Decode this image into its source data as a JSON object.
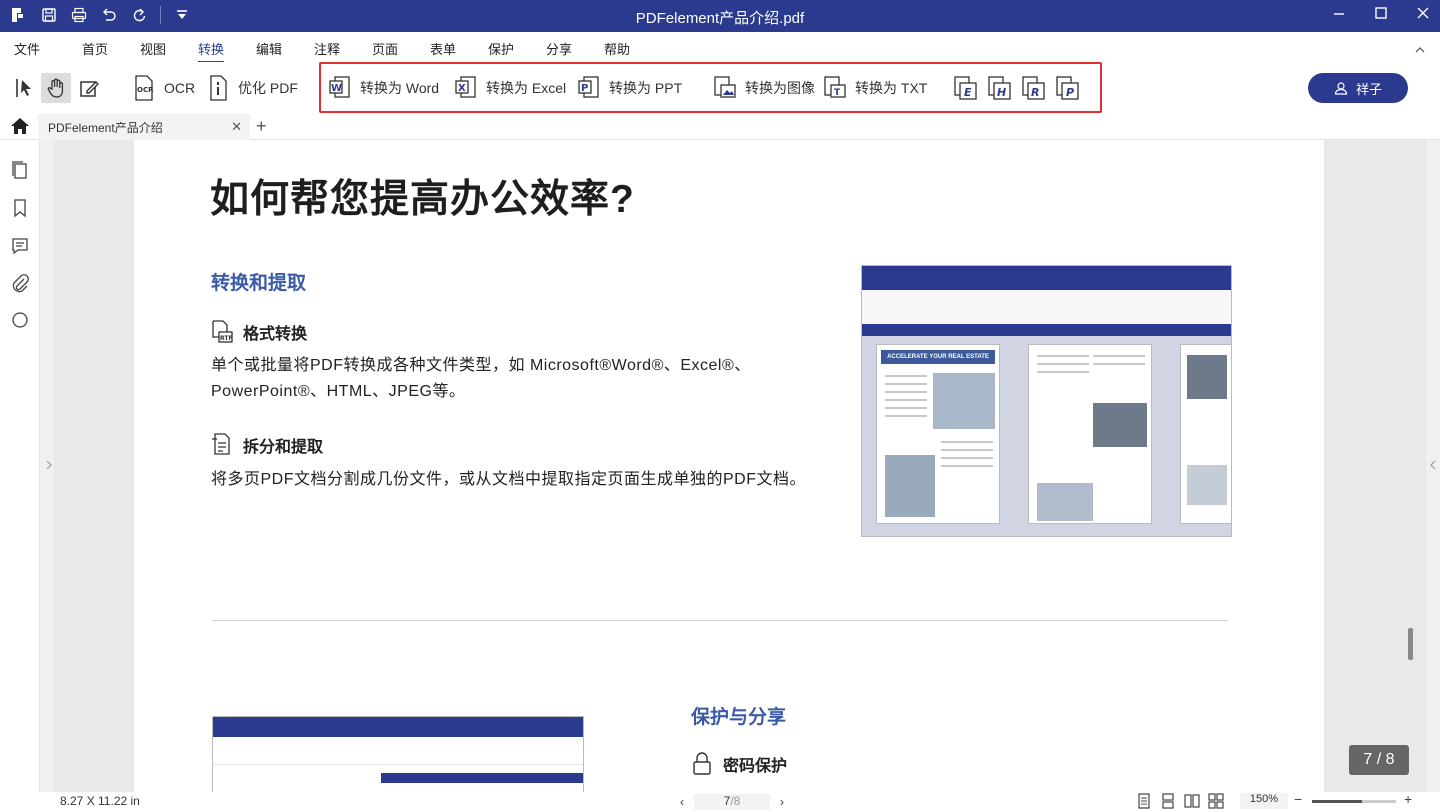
{
  "window": {
    "title": "PDFelement产品介绍.pdf"
  },
  "menu": {
    "items": [
      "文件",
      "首页",
      "视图",
      "转换",
      "编辑",
      "注释",
      "页面",
      "表单",
      "保护",
      "分享",
      "帮助"
    ],
    "active": "转换"
  },
  "toolbar": {
    "ocr": "OCR",
    "optimize": "优化 PDF",
    "to_word": "转换为  Word",
    "to_excel": "转换为  Excel",
    "to_ppt": "转换为  PPT",
    "to_image": "转换为图像",
    "to_txt": "转换为 TXT",
    "small_icons": [
      "E",
      "H",
      "R",
      "P"
    ],
    "user": "祥子"
  },
  "tabs": {
    "doc_tab": "PDFelement产品介绍"
  },
  "document": {
    "title": "如何帮您提高办公效率?",
    "section1": "转换和提取",
    "item1_title": "格式转换",
    "item1_line1": "单个或批量将PDF转换成各种文件类型，如 Microsoft®Word®、Excel®、",
    "item1_line2": "PowerPoint®、HTML、JPEG等。",
    "item2_title": "拆分和提取",
    "item2_text": "将多页PDF文档分割成几份文件，或从文档中提取指定页面生成单独的PDF文档。",
    "section2": "保护与分享",
    "item3_title": "密码保护",
    "screenshot_banner": "ACCELERATE YOUR REAL ESTATE DEALS"
  },
  "status": {
    "page_size": "8.27 X 11.22 in",
    "page_current": "7",
    "page_total": "/8",
    "badge": "7 / 8",
    "zoom": "150%",
    "zoom_level": 0.6
  },
  "colors": {
    "brand": "#2b3a8f",
    "highlight_box": "#e03030",
    "section_heading": "#3b5aa6"
  }
}
